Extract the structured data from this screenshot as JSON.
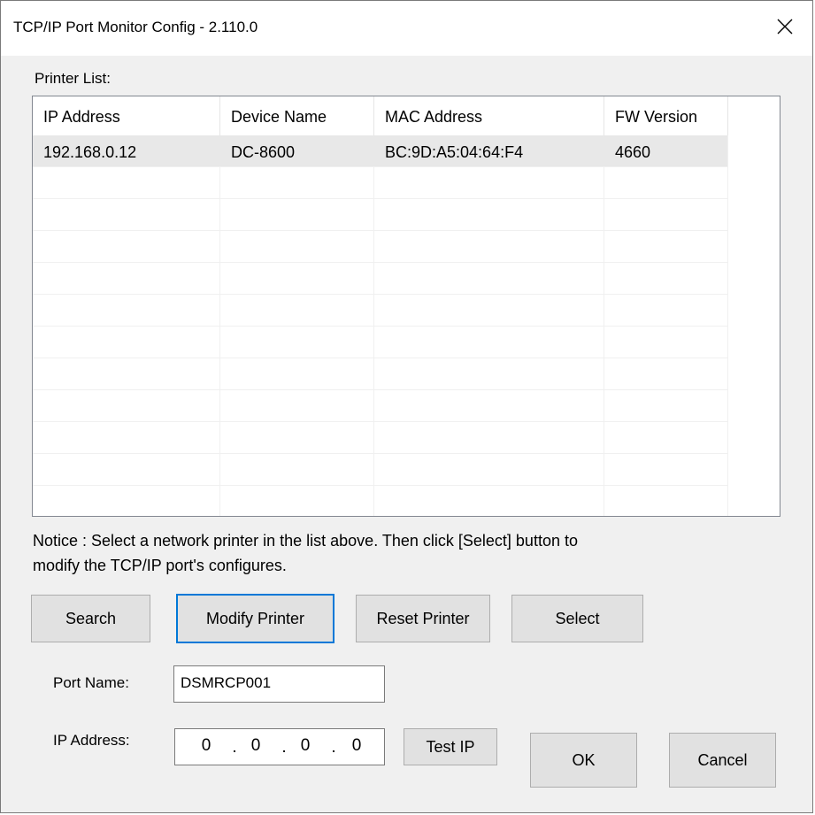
{
  "window": {
    "title": "TCP/IP Port Monitor Config - 2.110.0"
  },
  "printer_list": {
    "label": "Printer List:",
    "columns": [
      "IP Address",
      "Device Name",
      "MAC Address",
      "FW Version"
    ],
    "rows": [
      {
        "ip": "192.168.0.12",
        "device": "DC-8600",
        "mac": "BC:9D:A5:04:64:F4",
        "fw": "4660",
        "selected": true
      }
    ]
  },
  "notice": {
    "line1": "Notice : Select a network printer in the list above. Then click [Select] button to",
    "line2": "modify the TCP/IP port's configures."
  },
  "buttons": {
    "search": "Search",
    "modify_printer": "Modify Printer",
    "reset_printer": "Reset Printer",
    "select": "Select",
    "test_ip": "Test IP",
    "ok": "OK",
    "cancel": "Cancel"
  },
  "port_name": {
    "label": "Port Name:",
    "value": "DSMRCP001"
  },
  "ip_address": {
    "label": "IP Address:",
    "octets": [
      "0",
      "0",
      "0",
      "0"
    ]
  },
  "icons": {
    "close": "close-icon"
  }
}
